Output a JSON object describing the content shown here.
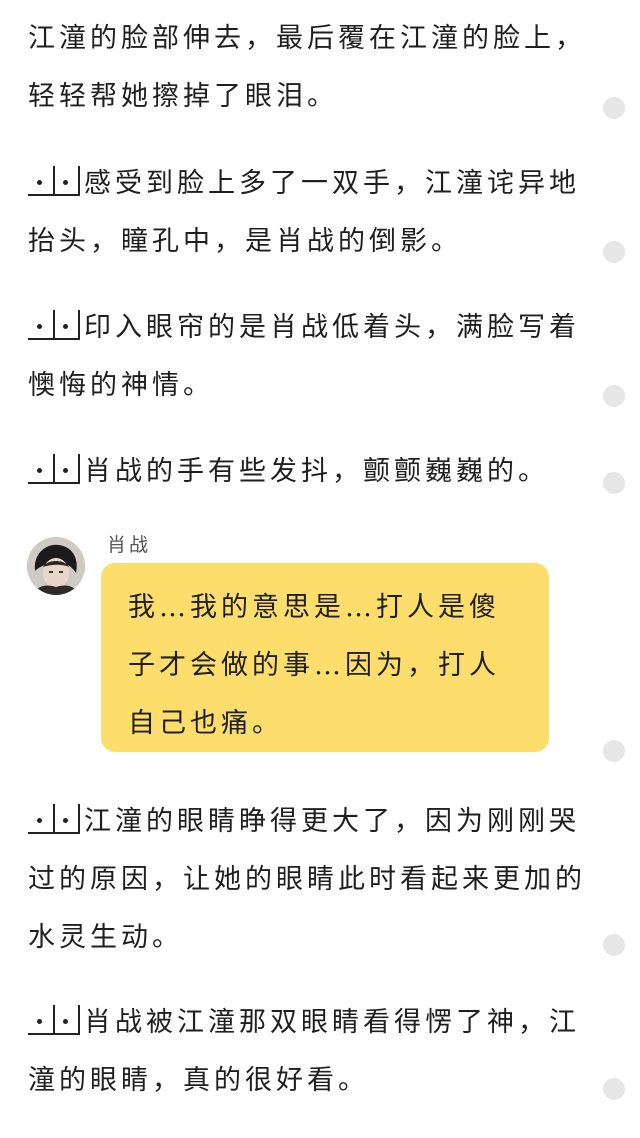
{
  "paragraphs": [
    {
      "text": "江潼的脸部伸去，最后覆在江潼的脸上，轻轻帮她擦掉了眼泪。",
      "marker": false
    },
    {
      "text": "感受到脸上多了一双手，江潼诧异地抬头，瞳孔中，是肖战的倒影。",
      "marker": true
    },
    {
      "text": "印入眼帘的是肖战低着头，满脸写着懊悔的神情。",
      "marker": true
    },
    {
      "text": "肖战的手有些发抖，颤颤巍巍的。",
      "marker": true
    },
    {
      "text": "江潼的眼睛睁得更大了，因为刚刚哭过的原因，让她的眼睛此时看起来更加的水灵生动。",
      "marker": true
    },
    {
      "text": "肖战被江潼那双眼睛看得愣了神，江潼的眼睛，真的很好看。",
      "marker": true
    }
  ],
  "dialogue": {
    "speaker": "肖战",
    "text": "我…我的意思是…打人是傻子才会做的事…因为，打人自己也痛。"
  },
  "colors": {
    "bubble": "#fdde6c",
    "side_dot": "#e6e6e6"
  }
}
